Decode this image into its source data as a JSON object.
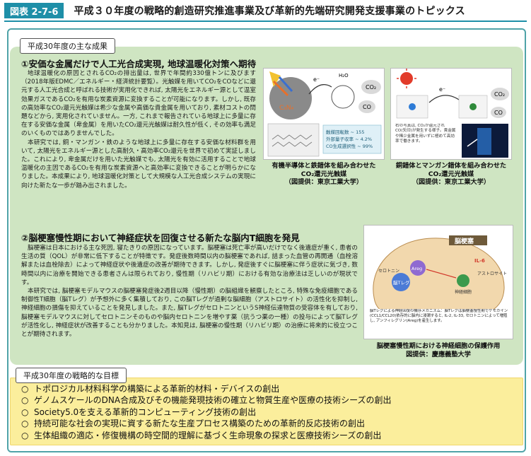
{
  "header": {
    "tag": "図表 2-7-6",
    "title": "平成３０年度の戦略的創造研究推進事業及び革新的先端研究開発支援事業のトピックス"
  },
  "results": {
    "label": "平成30年度の主な成果",
    "section1": {
      "title": "①安価な金属だけで人工光合成実現, 地球温暖化対策へ期待",
      "paragraphs": [
        "地球温暖化の原因とされるCO₂の排出量は, 世界で年間約330億トンに及びます（2018年版EDMC／エネルギー・経済統計要覧）。光触媒を用いてCO₂をCOなどに還元する人工光合成と呼ばれる技術が実用化できれば, 太陽光をエネルギー源として温室効果ガスであるCO₂を有用な炭素資源に変換することが可能になります。しかし, 既存の高効率なCO₂還元光触媒は希少な金属や高価な貴金属を用いており, 素材コストの問題などから, 実用化されていません。一方, これまで報告されている地球上に多量に存在する安価な金属（卑金属）を用いたCO₂還元光触媒は耐久性が低く, その効率も満足のいくものではありませんでした。",
        "本研究では, 銅・マンガン・鉄のような地球上に多量に存在する安価な材料群を用いて, 太陽光をエネルギー源とした高耐久・高効率CO₂還元を世界で初めて実証しました。これにより, 卑金属だけを用いた光触媒でも, 太陽光を有効に活用することで地球温暖化の主因であるCO₂を有用な炭素資源へと高効率に変換できることが明らかになりました。本成果により, 地球温暖化対策として大規模な人工光合成システムの実現に向けた新たな一歩が踏み出されました。"
      ],
      "figures": [
        {
          "caption_lines": [
            "有機半導体と鉄錯体を組み合わせた",
            "CO₂還元光触媒",
            "（図提供：東京工業大学）"
          ],
          "labels": {
            "co2": "CO₂",
            "co": "CO",
            "e": "e⁻",
            "h2o": "H₂O",
            "c3n4": "C₃N₄"
          },
          "info": [
            "触媒回転数 ~ 155",
            "外部量子収率 ~ 4.2%",
            "CO生成選択性 ~ 99%"
          ]
        },
        {
          "caption_lines": [
            "銅錯体とマンガン錯体を組み合わせた",
            "CO₂還元光触媒",
            "（図提供：東京工業大学）"
          ],
          "labels": {
            "co2": "CO₂",
            "co": "CO",
            "e": "e⁻"
          },
          "note": "右の写真は, CO₂が還元され CO(矢印)が発生する様子。貴金属や稀少金属を用いずに極めて高効率で働きます。"
        }
      ]
    },
    "section2": {
      "title": "②脳梗塞慢性期において神経症状を回復させる新たな脳内T細胞を発見",
      "paragraphs": [
        "脳梗塞は日本における主な死因, 寝たきりの原因になっています。脳梗塞は死亡率が高いだけでなく後遺症が重く, 患者の生活の質（QOL）が非常に低下することが特徴です。発症後数時間以内の脳梗塞であれば, 詰まった血管の再開通（血栓溶解または血栓除去）によって神経症状や後遺症の改善が期待できます。しかし, 発症後すぐに脳梗塞に伴う症状に気づき, 数時間以内に治療を開始できる患者さんは限られており, 慢性期（リハビリ期）における有効な治療法は乏しいのが現状です。",
        "本研究では, 脳梗塞モデルマウスの脳梗塞発症後2週目以降（慢性期）の脳組織を観察したところ, 特殊な免疫細胞である制御性T細胞（脳Tレグ）が予想外に多く集積しており, この脳Tレグが過剰な脳細胞（アストロサイト）の活性化を抑制し, 神経細胞の損傷を抑えていることを発見しました。また, 脳TレグがセロトニンというS神経伝達物質の受容体を有しており, 脳梗塞モデルマウスに対してセロトニンそのものや脳内セロトニンを増やす薬（抗うつ薬の一種）の投与によって脳Tレグが活性化し, 神経症状が改善することも分かりました。本知見は, 脳梗塞の慢性期（リハビリ期）の治療に将来的に役立つことが期待されます。"
      ],
      "figure": {
        "title": "脳梗塞",
        "labels": [
          "Areg",
          "IL-6",
          "脳Tレグ",
          "セロトニン",
          "神経細胞",
          "アストロサイト"
        ],
        "note": "脳Tレグによる神経回復の機序メカニズム：脳Tレグは脳梗塞慢性期でケモカイン(CCL1/CCL20)依存的に脳内に浸潤すると, IL-2, IL-33, セロトニンによって増殖し, アンフィレグリン(Areg)を産生します。",
        "caption_lines": [
          "脳梗塞慢性期における神経細胞の保護作用",
          "図提供：慶應義塾大学"
        ]
      }
    }
  },
  "goals": {
    "label": "平成30年度の戦略的な目標",
    "items": [
      "トポロジカル材料科学の構築による革新的材料・デバイスの創出",
      "ゲノムスケールのDNA合成及びその機能発現技術の確立と物質生産や医療の技術シーズの創出",
      "Society5.0を支える革新的コンピューティング技術の創出",
      "持続可能な社会の実現に資する新たな生産プロセス構築のための革新的反応技術の創出",
      "生体組織の適応・修復機構の時空間的理解に基づく生命現象の探求と医療技術シーズの創出"
    ],
    "bullet": "○"
  },
  "colors": {
    "accent": "#1e8fa8",
    "results_bg": "#cfe5c2",
    "goals_bg": "#fbee9c"
  }
}
